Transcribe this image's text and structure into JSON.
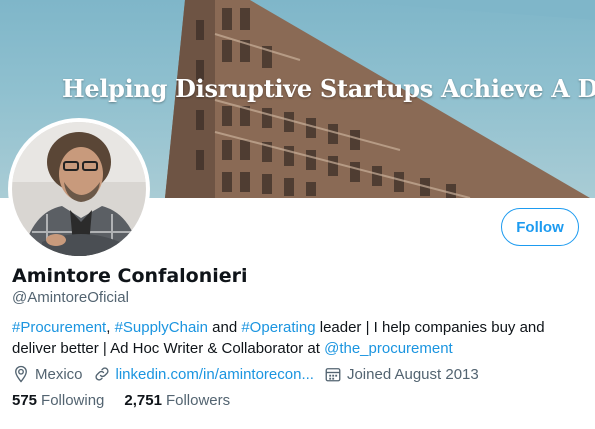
{
  "banner": {
    "headline": "Helping Disruptive Startups Achieve A Dream"
  },
  "profile": {
    "name": "Amintore Confalonieri",
    "handle": "@AmintoreOficial",
    "follow_label": "Follow",
    "bio": {
      "hashtag1": "#Procurement",
      "sep1": ", ",
      "hashtag2": "#SupplyChain",
      "sep2": " and ",
      "hashtag3": "#Operating",
      "text": " leader | I help companies buy and deliver better | Ad Hoc Writer & Collaborator at ",
      "mention": "@the_procurement"
    },
    "location": "Mexico",
    "website": "linkedin.com/in/amintorecon...",
    "joined": "Joined August 2013",
    "following_count": "575",
    "following_label": "Following",
    "followers_count": "2,751",
    "followers_label": "Followers"
  },
  "colors": {
    "accent": "#1d9bf0",
    "link": "#1b95e0",
    "secondary_text": "#536471"
  },
  "icons": [
    "location-icon",
    "link-icon",
    "calendar-icon"
  ]
}
